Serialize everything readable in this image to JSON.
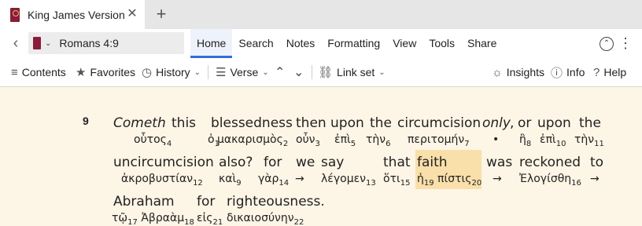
{
  "tab": {
    "title": "King James Version",
    "close": "✕",
    "new_tab": "+"
  },
  "toolbar": {
    "back": "‹",
    "reference": "Romans 4:9",
    "ref_chevron": "⌄",
    "menus": [
      "Home",
      "Search",
      "Notes",
      "Formatting",
      "View",
      "Tools",
      "Share"
    ],
    "active_menu": "Home",
    "up": "⌃",
    "more": "⋮"
  },
  "panel_toolbar": {
    "contents": "Contents",
    "favorites": "Favorites",
    "history": "History",
    "verse": "Verse",
    "link_set": "Link set",
    "insights": "Insights",
    "info": "Info",
    "help": "Help",
    "icons": [
      "list-icon",
      "star-icon",
      "clock-icon",
      "lines-icon",
      "up-arrow-icon",
      "down-arrow-icon",
      "link-icon",
      "bulb-icon",
      "info-icon",
      "help-icon"
    ]
  },
  "passage": {
    "verse_number": "9",
    "highlight_color": "#f9dfaa",
    "lines": [
      [
        {
          "en": "Cometh",
          "italic": true,
          "gr": "",
          "n": ""
        },
        {
          "en": "this",
          "italic": false,
          "gr": "οὗτος",
          "n": "4"
        },
        {
          "en": "",
          "italic": false,
          "gr": "ὁ",
          "n": "1"
        },
        {
          "en": "blessedness",
          "italic": false,
          "gr": "μακαρισμὸς",
          "n": "2"
        },
        {
          "en": "then",
          "italic": false,
          "gr": "οὖν",
          "n": "3"
        },
        {
          "en": "upon",
          "italic": false,
          "gr": "ἐπὶ",
          "n": "5"
        },
        {
          "en": "the",
          "italic": false,
          "gr": "τὴν",
          "n": "6"
        },
        {
          "en": "circumcision",
          "italic": false,
          "gr": "περιτομήν",
          "n": "7"
        },
        {
          "en": "only",
          "italic": true,
          "gr": "•",
          "n": ""
        },
        {
          "en": ",",
          "italic": false,
          "gr": "",
          "n": ""
        },
        {
          "en": "or",
          "italic": false,
          "gr": "ἢ",
          "n": "8"
        },
        {
          "en": "upon",
          "italic": false,
          "gr": "ἐπὶ",
          "n": "10"
        },
        {
          "en": "the",
          "italic": false,
          "gr": "τὴν",
          "n": "11"
        }
      ],
      [
        {
          "en": "uncircumcision",
          "italic": false,
          "gr": "ἀκροβυστίαν",
          "n": "12"
        },
        {
          "en": "also?",
          "italic": false,
          "gr": "καὶ",
          "n": "9"
        },
        {
          "en": "for",
          "italic": false,
          "gr": "γὰρ",
          "n": "14"
        },
        {
          "en": "we",
          "italic": false,
          "gr": "→",
          "n": ""
        },
        {
          "en": "say",
          "italic": false,
          "gr": "λέγομεν",
          "n": "13"
        },
        {
          "en": "that",
          "italic": false,
          "gr": "ὅτι",
          "n": "15"
        },
        {
          "en": "faith",
          "italic": false,
          "gr": "ἡ",
          "n": "19",
          "gr2": "πίστις",
          "n2": "20",
          "highlight": true
        },
        {
          "en": "was",
          "italic": false,
          "gr": "→",
          "n": ""
        },
        {
          "en": "reckoned",
          "italic": false,
          "gr": "Ἐλογίσθη",
          "n": "16"
        },
        {
          "en": "to",
          "italic": false,
          "gr": "→",
          "n": ""
        }
      ],
      [
        {
          "en": "Abraham",
          "italic": false,
          "gr": "τῷ",
          "n": "17",
          "gr2": "Ἀβραὰμ",
          "n2": "18"
        },
        {
          "en": "for",
          "italic": false,
          "gr": "εἰς",
          "n": "21"
        },
        {
          "en": "righteousness.",
          "italic": false,
          "gr": "δικαιοσύνην",
          "n": "22"
        }
      ]
    ]
  }
}
